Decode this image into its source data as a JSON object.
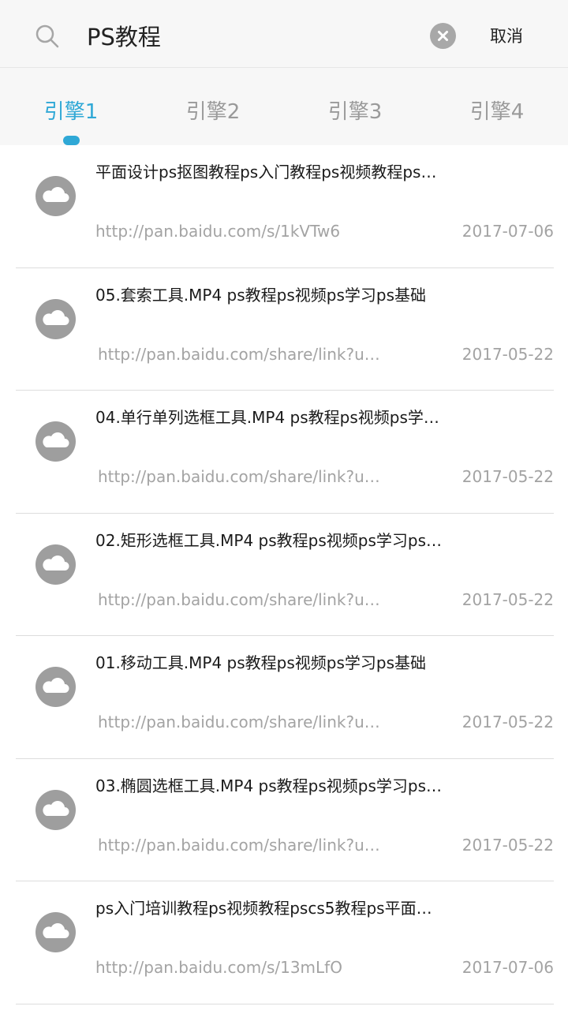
{
  "search": {
    "query": "PS教程",
    "cancel_label": "取消"
  },
  "tabs": [
    {
      "label": "引擎1",
      "active": true
    },
    {
      "label": "引擎2",
      "active": false
    },
    {
      "label": "引擎3",
      "active": false
    },
    {
      "label": "引擎4",
      "active": false
    }
  ],
  "results": [
    {
      "title": "平面设计ps抠图教程ps入门教程ps视频教程ps…",
      "link": "http://pan.baidu.com/s/1kVTw6",
      "date": "2017-07-06"
    },
    {
      "title": "05.套索工具.MP4 ps教程ps视频ps学习ps基础",
      "link": "http://pan.baidu.com/share/link?u…",
      "date": "2017-05-22"
    },
    {
      "title": "04.单行单列选框工具.MP4 ps教程ps视频ps学…",
      "link": "http://pan.baidu.com/share/link?u…",
      "date": "2017-05-22"
    },
    {
      "title": "02.矩形选框工具.MP4 ps教程ps视频ps学习ps…",
      "link": "http://pan.baidu.com/share/link?u…",
      "date": "2017-05-22"
    },
    {
      "title": "01.移动工具.MP4 ps教程ps视频ps学习ps基础",
      "link": "http://pan.baidu.com/share/link?u…",
      "date": "2017-05-22"
    },
    {
      "title": "03.椭圆选框工具.MP4 ps教程ps视频ps学习ps…",
      "link": "http://pan.baidu.com/share/link?u…",
      "date": "2017-05-22"
    },
    {
      "title": "ps入门培训教程ps视频教程pscs5教程ps平面…",
      "link": "http://pan.baidu.com/s/13mLfO",
      "date": "2017-07-06"
    }
  ],
  "icons": {
    "search": "search-icon",
    "clear": "clear-icon",
    "result": "cloud-icon"
  },
  "colors": {
    "accent": "#2fa8d6",
    "icon_gray": "#9e9e9e",
    "muted_text": "#a3a3a3"
  }
}
